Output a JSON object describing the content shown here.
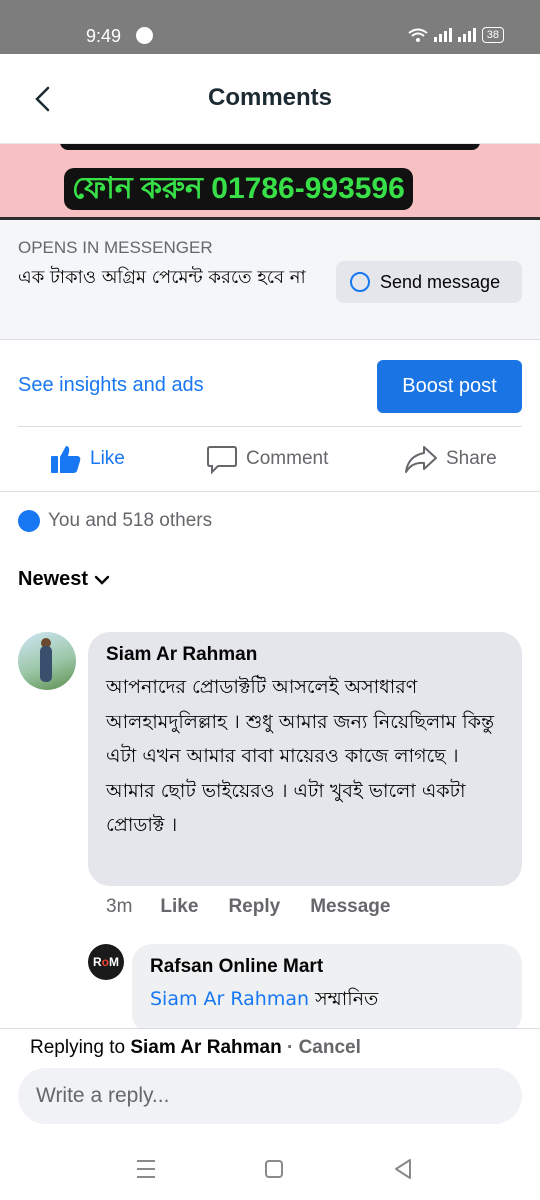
{
  "status_bar": {
    "time": "9:49",
    "battery": "38"
  },
  "header": {
    "title": "Comments"
  },
  "ad": {
    "phone_text": "ফোন করুন 01786-993596",
    "opens_label": "OPENS IN MESSENGER",
    "text": "এক টাকাও অগ্রিম পেমেন্ট করতে হবে না",
    "send_label": "Send message",
    "insights_label": "See insights and ads",
    "boost_label": "Boost post"
  },
  "actions": {
    "like": "Like",
    "comment": "Comment",
    "share": "Share"
  },
  "reactions": {
    "text": "You and 518 others"
  },
  "sort": {
    "label": "Newest"
  },
  "comments": [
    {
      "author": "Siam Ar Rahman",
      "text": "আপনাদের প্রোডাক্টটি আসলেই অসাধারণ আলহামদুলিল্লাহ । শুধু আমার জন্য নিয়েছিলাম কিন্তু এটা এখন আমার বাবা মায়েরও কাজে লাগছে । আমার ছোট ভাইয়েরও । এটা খুবই ভালো একটা প্রোডাক্ট ।",
      "time": "3m",
      "like": "Like",
      "reply": "Reply",
      "message": "Message"
    }
  ],
  "reply": {
    "author": "Rafsan Online Mart",
    "mention": "Siam Ar Rahman",
    "text": "সম্মানিত"
  },
  "reply_bar": {
    "prefix": "Replying to",
    "name": "Siam Ar Rahman",
    "cancel": "· Cancel",
    "placeholder": "Write a reply..."
  },
  "colors": {
    "brand_blue": "#1877f2",
    "ad_bg": "#f7c1c4",
    "ad_green": "#38e048"
  }
}
